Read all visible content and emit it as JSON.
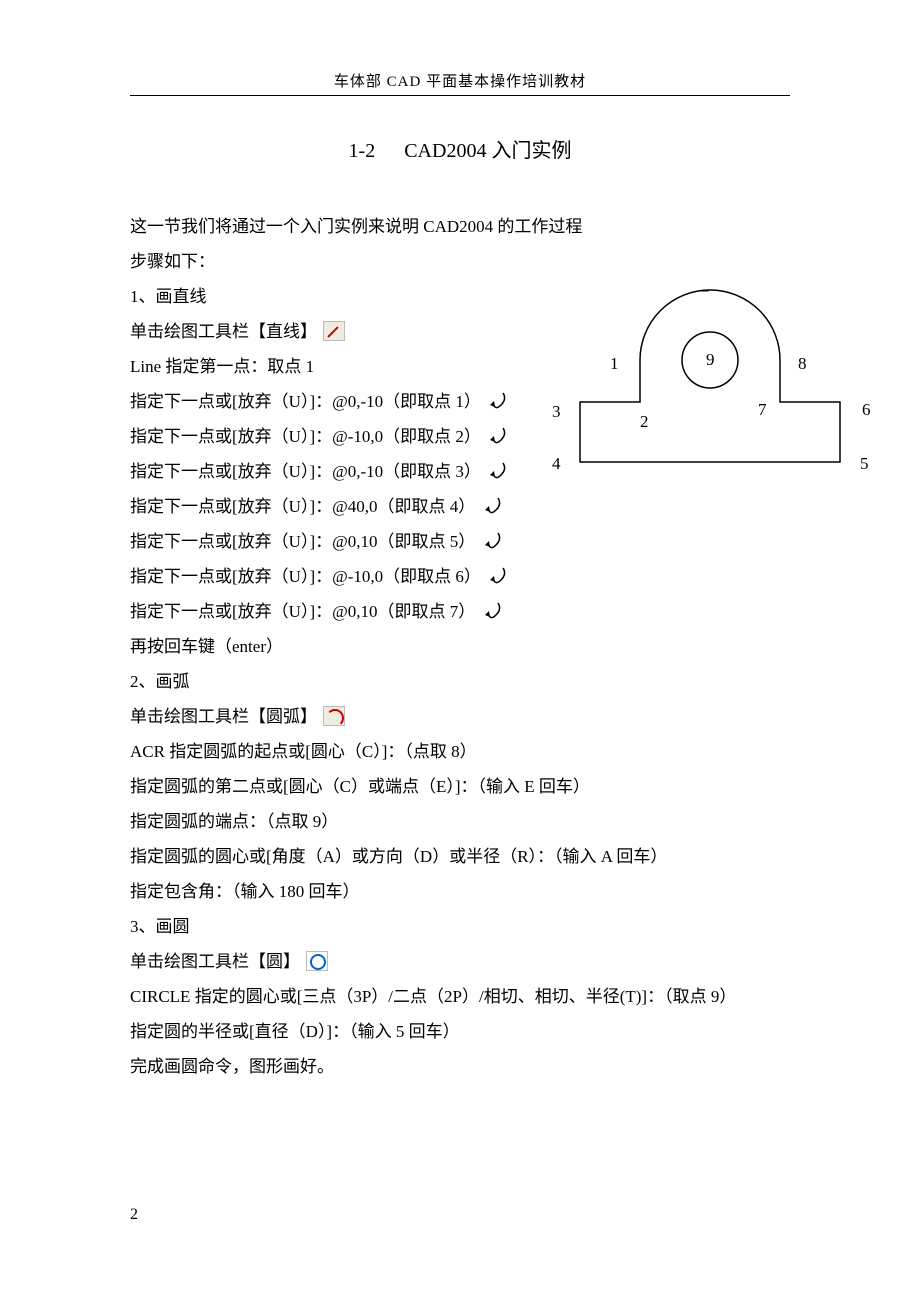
{
  "header": "车体部   CAD 平面基本操作培训教材",
  "section_number": "1-2",
  "section_title": "CAD2004 入门实例",
  "intro": "这一节我们将通过一个入门实例来说明 CAD2004 的工作过程",
  "steps_label": "步骤如下：",
  "lines": {
    "s1": "1、画直线",
    "s1a": "单击绘图工具栏【直线】",
    "s1b": "Line 指定第一点：取点 1",
    "s1c": "指定下一点或[放弃（U）]：@0,-10（即取点 1）",
    "s1d": "指定下一点或[放弃（U）]：@-10,0（即取点 2）",
    "s1e": "指定下一点或[放弃（U）]：@0,-10（即取点 3）",
    "s1f": "指定下一点或[放弃（U）]：@40,0（即取点 4）",
    "s1g": "指定下一点或[放弃（U）]：@0,10（即取点 5）",
    "s1h": "指定下一点或[放弃（U）]：@-10,0（即取点 6）",
    "s1i": "指定下一点或[放弃（U）]：@0,10（即取点 7）",
    "s1j": "再按回车键（enter）",
    "s2": "2、画弧",
    "s2a": "单击绘图工具栏【圆弧】",
    "s2b": "ACR 指定圆弧的起点或[圆心（C）]：（点取 8）",
    "s2c": "指定圆弧的第二点或[圆心（C）或端点（E）]：（输入 E  回车）",
    "s2d": "指定圆弧的端点：（点取 9）",
    "s2e": "指定圆弧的圆心或[角度（A）或方向（D）或半径（R）：（输入 A 回车）",
    "s2f": "指定包含角：（输入 180   回车）",
    "s3": "3、画圆",
    "s3a": "单击绘图工具栏【圆】",
    "s3b": "CIRCLE 指定的圆心或[三点（3P）/二点（2P）/相切、相切、半径(T)]：（取点 9）",
    "s3c": "指定圆的半径或[直径（D）]：（输入 5   回车）",
    "s3d": "完成画圆命令，图形画好。"
  },
  "figure_labels": {
    "p1": "1",
    "p2": "2",
    "p3": "3",
    "p4": "4",
    "p5": "5",
    "p6": "6",
    "p7": "7",
    "p8": "8",
    "p9": "9",
    "dash": "–"
  },
  "page_number": "2"
}
